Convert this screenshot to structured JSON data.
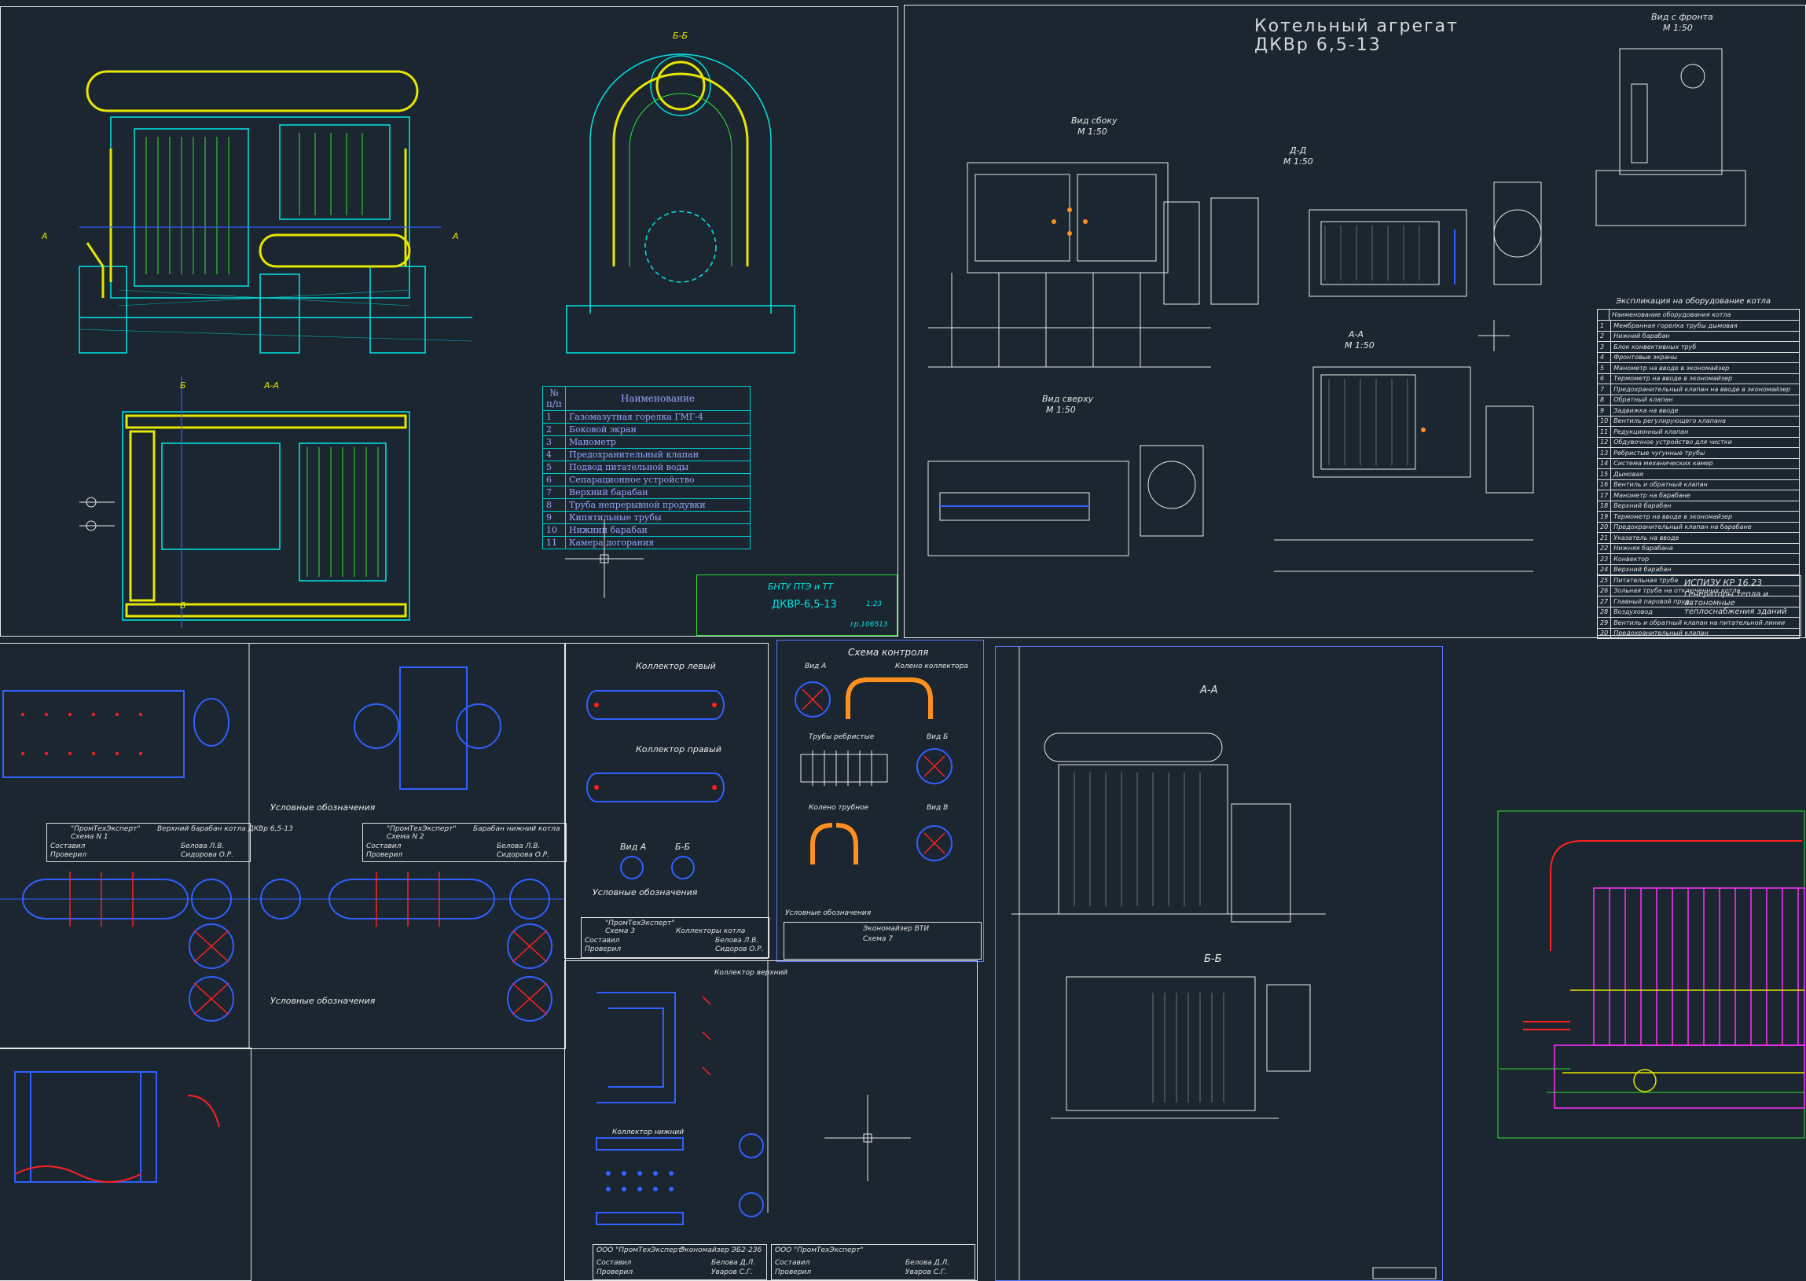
{
  "sheet1": {
    "section_bb": "Б-Б",
    "section_aa": "А-А",
    "section_mark_a": "А",
    "section_mark_b": "Б",
    "spec_table": {
      "header_num": "№ п/п",
      "header_name": "Наименование",
      "rows": [
        {
          "n": "1",
          "name": "Газомазутная горелка ГМГ-4"
        },
        {
          "n": "2",
          "name": "Боковой экран"
        },
        {
          "n": "3",
          "name": "Манометр"
        },
        {
          "n": "4",
          "name": "Предохранительный клапан"
        },
        {
          "n": "5",
          "name": "Подвод питательной воды"
        },
        {
          "n": "6",
          "name": "Сепарационное устройство"
        },
        {
          "n": "7",
          "name": "Верхний барабан"
        },
        {
          "n": "8",
          "name": "Труба непрерывной продувки"
        },
        {
          "n": "9",
          "name": "Кипятильные трубы"
        },
        {
          "n": "10",
          "name": "Нижний барабан"
        },
        {
          "n": "11",
          "name": "Камера догорания"
        }
      ]
    },
    "stamp": {
      "org": "БНТУ   ПТЭ и ТТ",
      "title": "ДКВР-6,5-13",
      "scale": "1:23",
      "group": "гр.106513"
    }
  },
  "sheet2": {
    "title_line1": "Котельный агрегат",
    "title_line2": "ДКВр 6,5-13",
    "view_front": "Вид с фронта",
    "view_front_scale": "М 1:50",
    "view_side": "Вид сбоку",
    "view_side_scale": "М 1:50",
    "view_top": "Вид сверху",
    "view_top_scale": "М 1:50",
    "section_dd": "Д-Д",
    "section_dd_scale": "М 1:50",
    "section_aa": "А-А",
    "section_aa_scale": "М 1:50",
    "explication_title": "Экспликация на оборудование котла",
    "explication_header": "Наименование оборудования котла",
    "explication_rows": [
      "Мембранная горелка трубы дымовая",
      "Нижний барабан",
      "Блок конвективных труб",
      "Фронтовые экраны",
      "Манометр на вводе в экономайзер",
      "Термометр на вводе в экономайзер",
      "Предохранительный клапан на вводе в экономайзер",
      "Обратный клапан",
      "Задвижка на вводе",
      "Вентиль регулирующего клапана",
      "Редукционный клапан",
      "Обдувочное устройство для чистки",
      "Ребристые чугунные трубы",
      "Система механических камер",
      "Дымовая",
      "Вентиль и обратный клапан",
      "Манометр на барабане",
      "Верхний барабан",
      "Термометр на вводе в экономайзер",
      "Предохранительный клапан на барабане",
      "Указатель на вводе",
      "Нижняя барабана",
      "Конвектор",
      "Верхний барабан",
      "Питательная труба",
      "Зольная труба на отключенных котла",
      "Главный паровой пруд",
      "Воздуховод",
      "Вентиль и обратный клапан на питательной линии",
      "Предохранительный клапан"
    ],
    "stamp": {
      "code": "ИСПИЗУ КР 16.23",
      "title": "Генераторы тепла и автономные теплоснабжения зданий"
    }
  },
  "sheet3": {
    "legend_title": "Условные обозначения",
    "stamp_org": "\"ПромТехЭксперт\"",
    "stamp_title_1": "Верхний барабан котла ДКВр 6,5-13",
    "stamp_title_2": "Барабан нижний котла",
    "scheme_1": "Схема N 1",
    "scheme_2": "Схема N 2",
    "compiled": "Составил",
    "checked": "Проверил",
    "name1": "Белова Л.В.",
    "name2": "Сидорова О.Р."
  },
  "sheet4": {
    "label_upper": "Коллектор левый",
    "label_lower": "Коллектор правый",
    "view_a": "Вид А",
    "view_b": "Б-Б",
    "legend_title": "Условные обозначения",
    "stamp_org": "\"ПромТехЭксперт\"",
    "stamp_title": "Коллекторы котла",
    "scheme": "Схема 3",
    "compiled": "Составил",
    "checked": "Проверил",
    "name1": "Белова Л.В.",
    "name2": "Сидоров О.Р."
  },
  "sheet5": {
    "title": "Схема контроля",
    "view_a": "Вид А",
    "elbow": "Колено коллектора",
    "pipe_tube": "Трубы ребристые",
    "view_b": "Вид Б",
    "elbow_pipe": "Колено трубное",
    "view_v": "Вид В",
    "legend": "Условные обозначения",
    "stamp_title": "Экономайзер ВТИ",
    "scheme": "Схема 7"
  },
  "sheet6": {
    "label_a": "Коллектор верхний",
    "label_b": "Коллектор нижний",
    "stamp_org": "ООО \"ПромТехЭксперт\"",
    "stamp_title": "Экономайзер ЭБ2-236",
    "compiled": "Составил",
    "checked": "Проверил",
    "name1": "Белова Д.Л.",
    "name2": "Уваров С.Г."
  },
  "sheet7": {
    "section_aa": "А-А",
    "section_bb": "Б-Б"
  },
  "colors": {
    "background": "#1b2630",
    "sheet_border": "#e8e8e8",
    "cyan": "#00e5e5",
    "yellow": "#e6e600",
    "green": "#30e030",
    "blue": "#3060ff",
    "red": "#ff2020",
    "magenta": "#ff30ff",
    "white": "#ffffff",
    "orange": "#ff9020"
  }
}
